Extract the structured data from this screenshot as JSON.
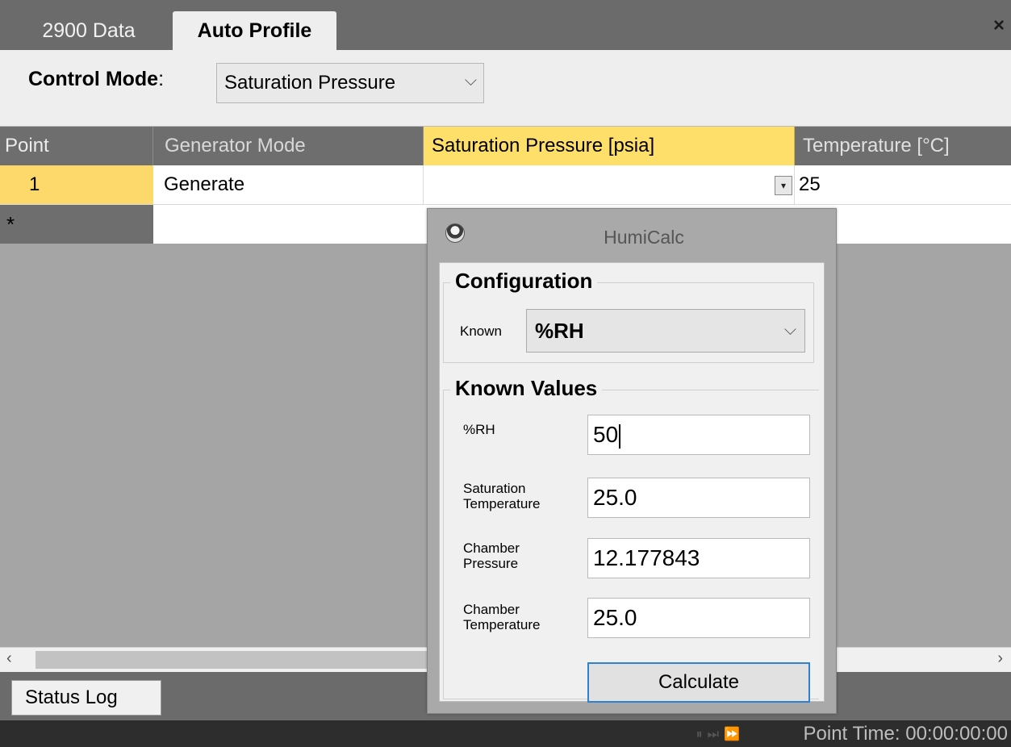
{
  "tabs": [
    {
      "label": "2900 Data",
      "active": false
    },
    {
      "label": "Auto Profile",
      "active": true
    }
  ],
  "close_glyph": "×",
  "control_mode": {
    "label": "Control Mode",
    "colon": ":",
    "value": "Saturation Pressure"
  },
  "grid": {
    "columns": [
      "Point",
      "Generator Mode",
      "Saturation Pressure [psia]",
      "Temperature [°C]"
    ],
    "rows": [
      {
        "point": "1",
        "generator_mode": "Generate",
        "saturation_pressure": "",
        "temperature": "25"
      }
    ],
    "new_row_marker": "*"
  },
  "bottom": {
    "status_tab": "Status Log",
    "point_time": "Point Time: 00:00:00:00"
  },
  "humicalc": {
    "title": "HumiCalc",
    "configuration": {
      "title": "Configuration",
      "known_label": "Known",
      "known_value": "%RH"
    },
    "known_values": {
      "title": "Known Values",
      "fields": [
        {
          "label": "%RH",
          "value": "50"
        },
        {
          "label": "Saturation Temperature",
          "value": "25.0"
        },
        {
          "label": "Chamber Pressure",
          "value": "12.177843"
        },
        {
          "label": "Chamber Temperature",
          "value": "25.0"
        }
      ]
    },
    "calculate_label": "Calculate"
  },
  "colors": {
    "accent_header": "#fedf69",
    "selected_cell": "#fdd96b",
    "button_focus": "#2f7fd3"
  }
}
